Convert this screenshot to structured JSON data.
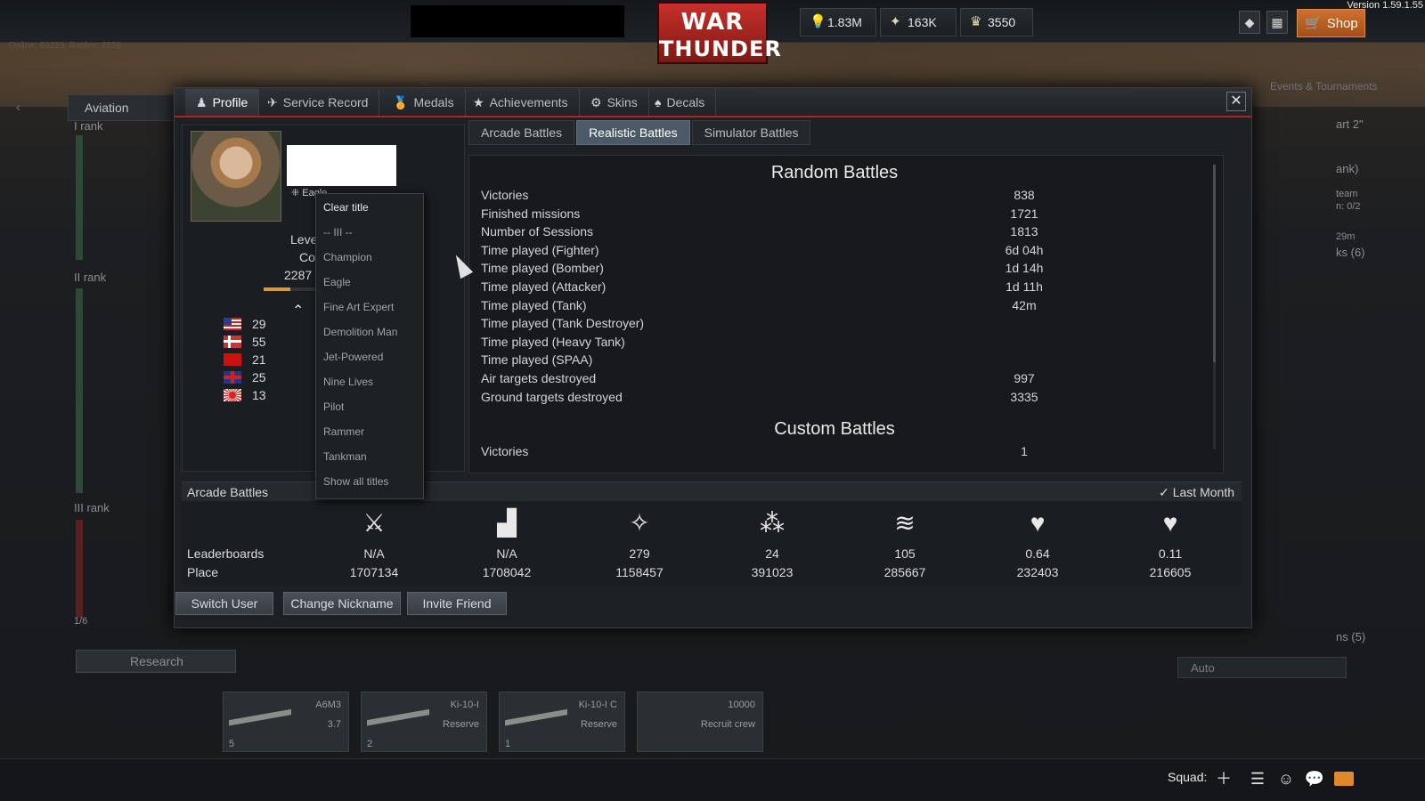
{
  "app": {
    "version": "Version 1.59.1.55",
    "logo_line1": "WAR",
    "logo_line2": "THUNDER",
    "online_text": "Online: 63223, Battles: 2558"
  },
  "currencies": [
    {
      "icon": "lion-icon",
      "value": "1.83M"
    },
    {
      "icon": "research-points-icon",
      "value": "163K"
    },
    {
      "icon": "golden-eagles-icon",
      "value": "3550"
    }
  ],
  "topbar": {
    "shop_label": "Shop",
    "events_label": "Events & Tournaments"
  },
  "background": {
    "aviation_label": "Aviation",
    "ranks": [
      "I rank",
      "II rank",
      "III rank"
    ],
    "progress": "1/6",
    "right_texts": [
      "art 2\"",
      "ank)",
      "team",
      "n: 0/2",
      "29m",
      "ks (6)",
      "ns (5)"
    ],
    "research_label": "Research",
    "auto_label": "Auto",
    "vehicles": [
      {
        "name": "A6M3",
        "br": "3.7",
        "crew": "5"
      },
      {
        "name": "Ki-10-I",
        "br": "Reserve",
        "crew": "2"
      },
      {
        "name": "Ki-10-I C",
        "br": "Reserve",
        "crew": "1"
      },
      {
        "name": "10000",
        "br": "Recruit crew",
        "crew": ""
      }
    ]
  },
  "profile": {
    "tabs": [
      "Profile",
      "Service Record",
      "Medals",
      "Achievements",
      "Skins",
      "Decals"
    ],
    "title_selected": "Eagle",
    "level_label": "Leve",
    "level_line2": "Co",
    "xp_text": "2287",
    "xp_fraction": 0.5,
    "countries": [
      {
        "flag": "usa",
        "value": "29"
      },
      {
        "flag": "germany",
        "value": "55"
      },
      {
        "flag": "ussr",
        "value": "21"
      },
      {
        "flag": "britain",
        "value": "25"
      },
      {
        "flag": "japan",
        "value": "13"
      }
    ],
    "battle_tabs": [
      "Arcade Battles",
      "Realistic Battles",
      "Simulator Battles"
    ],
    "active_battle_tab": "Realistic Battles",
    "random_battles": {
      "heading": "Random Battles",
      "rows": [
        {
          "k": "Victories",
          "v": "838"
        },
        {
          "k": "Finished missions",
          "v": "1721"
        },
        {
          "k": "Number of Sessions",
          "v": "1813"
        },
        {
          "k": "Time played (Fighter)",
          "v": "6d 04h"
        },
        {
          "k": "Time played (Bomber)",
          "v": "1d 14h"
        },
        {
          "k": "Time played (Attacker)",
          "v": "1d 11h"
        },
        {
          "k": "Time played (Tank)",
          "v": "42m"
        },
        {
          "k": "Time played (Tank Destroyer)",
          "v": ""
        },
        {
          "k": "Time played (Heavy Tank)",
          "v": ""
        },
        {
          "k": "Time played (SPAA)",
          "v": ""
        },
        {
          "k": "Air targets destroyed",
          "v": "997"
        },
        {
          "k": "Ground targets destroyed",
          "v": "3335"
        }
      ]
    },
    "custom_battles": {
      "heading": "Custom Battles",
      "rows": [
        {
          "k": "Victories",
          "v": "1"
        }
      ]
    },
    "leaderboard": {
      "mode_label": "Arcade Battles",
      "period_label": "Last Month",
      "row1_label": "Leaderboards",
      "row2_label": "Place",
      "columns": [
        {
          "icon": "crossed-swords-icon",
          "value": "N/A",
          "place": "1707134"
        },
        {
          "icon": "podium-icon",
          "value": "N/A",
          "place": "1708042"
        },
        {
          "icon": "star-diamond-icon",
          "value": "279",
          "place": "1158457"
        },
        {
          "icon": "three-stars-icon",
          "value": "24",
          "place": "391023"
        },
        {
          "icon": "wings-icon",
          "value": "105",
          "place": "285667"
        },
        {
          "icon": "air-kills-heart-icon",
          "value": "0.64",
          "place": "232403"
        },
        {
          "icon": "ground-kills-heart-icon",
          "value": "0.11",
          "place": "216605"
        }
      ]
    },
    "buttons": {
      "switch_user": "Switch User",
      "change_nickname": "Change Nickname",
      "invite_friend": "Invite Friend"
    }
  },
  "title_menu": [
    "Clear title",
    "-- III --",
    "Champion",
    "Eagle",
    "Fine Art Expert",
    "Demolition Man",
    "Jet-Powered",
    "Nine Lives",
    "Pilot",
    "Rammer",
    "Tankman",
    "Show all titles"
  ],
  "bottombar": {
    "squad_label": "Squad:"
  }
}
